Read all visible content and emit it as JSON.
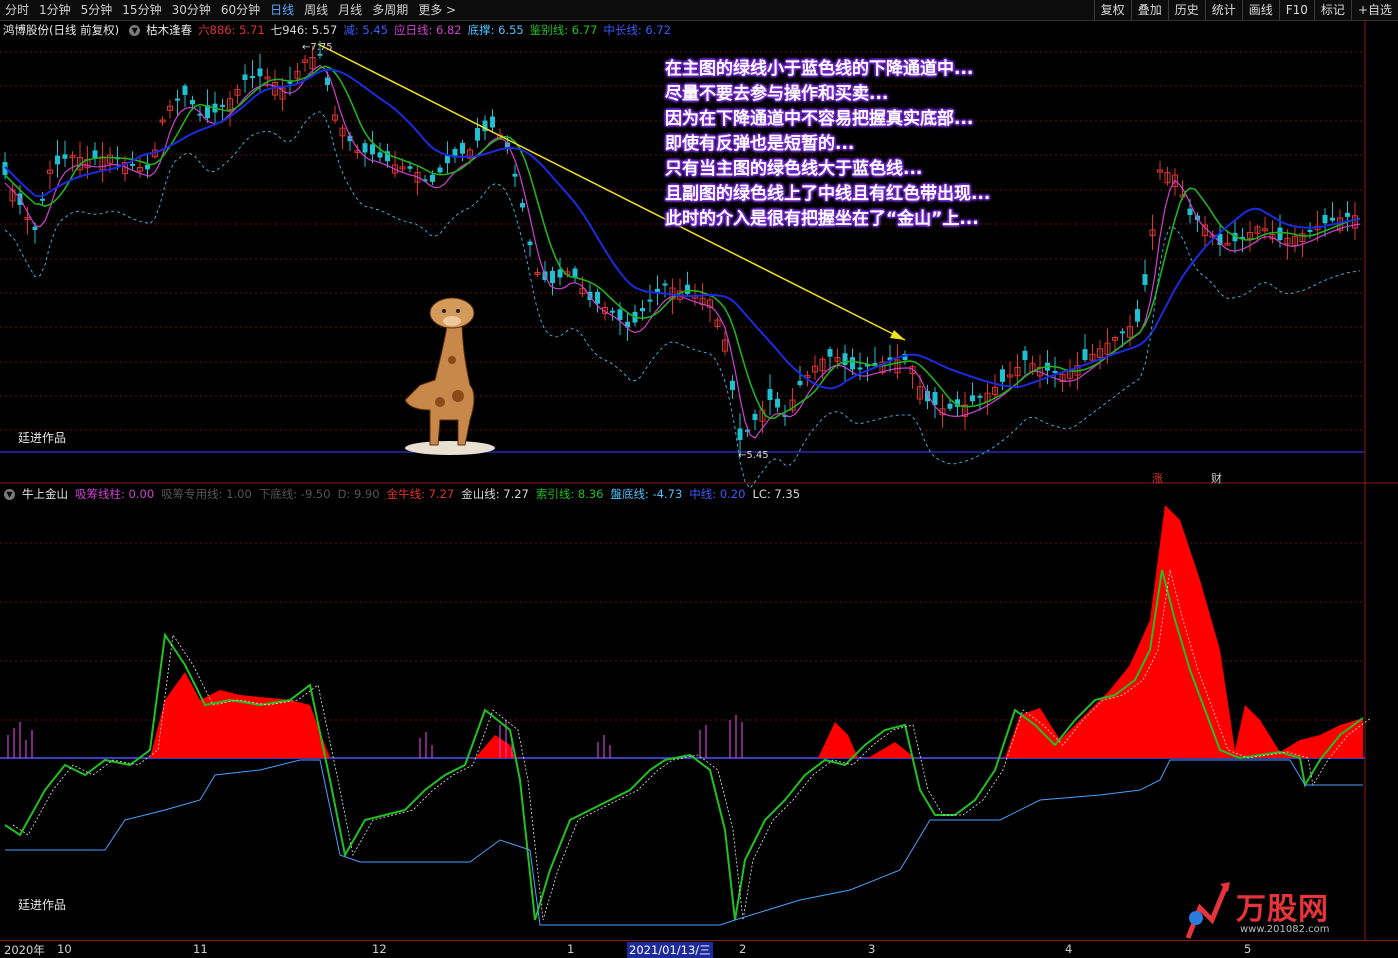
{
  "toolbar": {
    "periods": [
      "分时",
      "1分钟",
      "5分钟",
      "15分钟",
      "30分钟",
      "60分钟",
      "日线",
      "周线",
      "月线",
      "多周期",
      "更多 >"
    ],
    "active_period": "日线",
    "tools": [
      "复权",
      "叠加",
      "历史",
      "统计",
      "画线",
      "F10",
      "标记",
      "+自选"
    ]
  },
  "main_panel": {
    "stock_title": "鸿博股份(日线 前复权)",
    "indicator_name": "枯木逢春",
    "params": [
      {
        "label": "六886: 5.71",
        "color": "#e0332e"
      },
      {
        "label": "七946: 5.57",
        "color": "#d8d8d8"
      },
      {
        "label": "减: 5.45",
        "color": "#3a5bff"
      },
      {
        "label": "应日线: 6.82",
        "color": "#d040d0"
      },
      {
        "label": "底撑: 6.55",
        "color": "#50c0ff"
      },
      {
        "label": "鉴别线: 6.77",
        "color": "#20c020"
      },
      {
        "label": "中长线: 6.72",
        "color": "#3a5bff"
      }
    ],
    "high_label": "7.75",
    "low_label": "5.45",
    "author_label": "廷进作品",
    "flags": [
      {
        "label": "涨",
        "color": "#e0332e"
      },
      {
        "label": "财",
        "color": "#d0d0d0"
      }
    ]
  },
  "annotation": {
    "lines": [
      "在主图的绿线小于蓝色线的下降通道中...",
      "尽量不要去参与操作和买卖...",
      "因为在下降通道中不容易把握真实底部...",
      "即使有反弹也是短暂的...",
      "只有当主图的绿色线大于蓝色线...",
      "且副图的绿色线上了中线且有红色带出现...",
      "此时的介入是很有把握坐在了“金山”上..."
    ]
  },
  "sub_panel": {
    "indicator_name": "牛上金山",
    "params": [
      {
        "label": "吸筹线柱: 0.00",
        "color": "#d040d0"
      },
      {
        "label": "吸筹专用线: 1.00",
        "color": "#555555"
      },
      {
        "label": "下底线: -9.50",
        "color": "#555555"
      },
      {
        "label": "D: 9.90",
        "color": "#555555"
      },
      {
        "label": "金牛线: 7.27",
        "color": "#e0332e"
      },
      {
        "label": "金山线: 7.27",
        "color": "#d8d8d8"
      },
      {
        "label": "索引线: 8.36",
        "color": "#20c020"
      },
      {
        "label": "盤底线: -4.73",
        "color": "#50c0ff"
      },
      {
        "label": "中线: 0.20",
        "color": "#3a5bff"
      },
      {
        "label": "LC: 7.35",
        "color": "#d8d8d8"
      }
    ],
    "author_label": "廷进作品"
  },
  "xaxis": {
    "labels": [
      "2020年",
      "10",
      "11",
      "12",
      "1",
      "2021/01/13/三",
      "2",
      "3",
      "4",
      "5"
    ]
  },
  "logo": {
    "text": "万股网",
    "url": "www.201082.com"
  },
  "colors": {
    "up": "#e0332e",
    "down": "#20c0d0",
    "blue_ma": "#1a2be0",
    "green_ma": "#20b020",
    "magenta": "#d040d0",
    "cyan_dash": "#40a8d8",
    "yellow_trend": "#f0e020",
    "red_fill": "#ff0000"
  }
}
